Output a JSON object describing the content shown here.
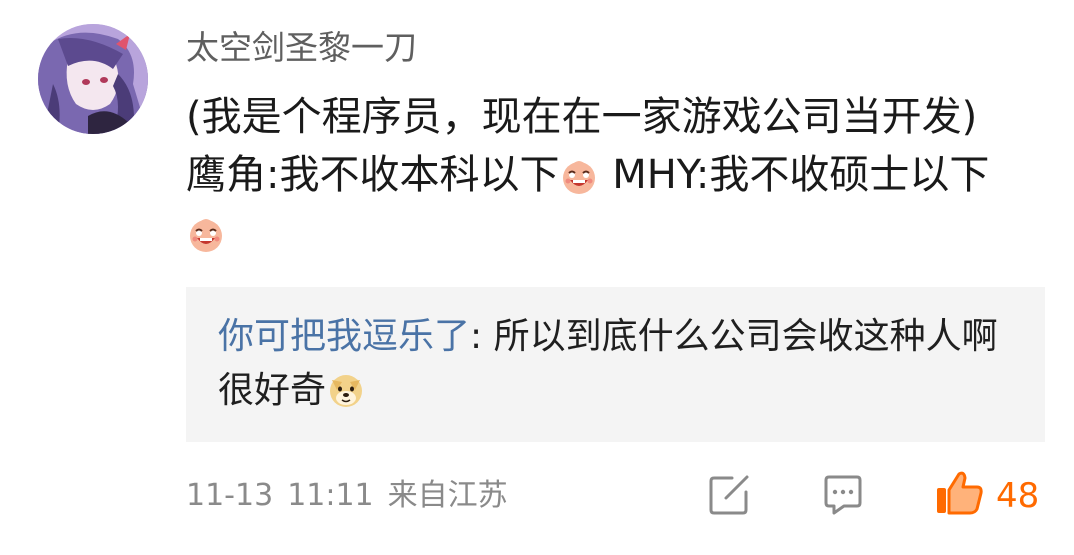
{
  "comment": {
    "username": "太空剑圣黎一刀",
    "text_part1": "(我是个程序员，现在在一家游戏公司当开发)  鹰角:我不收本科以下",
    "text_part2": "  MHY:我不收硕士以下 ",
    "emoji": "laughing-emoji"
  },
  "quote": {
    "username": "你可把我逗乐了",
    "separator": ": ",
    "text": "所以到底什么公司会收这种人啊很好奇",
    "emoji": "doge-emoji"
  },
  "meta": {
    "date": "11-13",
    "time": "11:11",
    "location": "来自江苏"
  },
  "actions": {
    "like_count": "48"
  },
  "colors": {
    "accent": "#ff6a00",
    "quote_user": "#4a73a6",
    "quote_bg": "#f4f4f4"
  }
}
